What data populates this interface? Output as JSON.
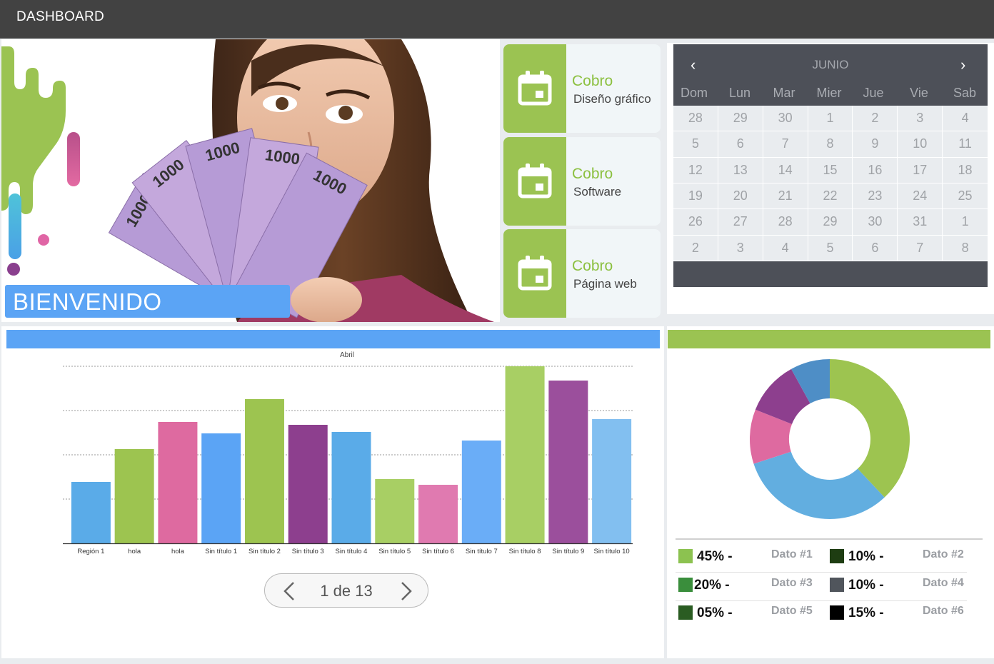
{
  "header": {
    "title": "DASHBOARD"
  },
  "hero": {
    "welcome": "BIENVENIDO",
    "image": "woman-holding-money-image",
    "banknote_labels": [
      "1000",
      "1000",
      "1000",
      "1000",
      "1000"
    ]
  },
  "cobros": [
    {
      "title": "Cobro",
      "subtitle": "Diseño gráfico",
      "icon": "calendar-icon"
    },
    {
      "title": "Cobro",
      "subtitle": "Software",
      "icon": "calendar-icon"
    },
    {
      "title": "Cobro",
      "subtitle": "Página web",
      "icon": "calendar-icon"
    }
  ],
  "calendar": {
    "month": "JUNIO",
    "prev": "‹",
    "next": "›",
    "weekdays": [
      "Dom",
      "Lun",
      "Mar",
      "Mier",
      "Jue",
      "Vie",
      "Sab"
    ],
    "weeks": [
      [
        "28",
        "29",
        "30",
        "1",
        "2",
        "3",
        "4"
      ],
      [
        "5",
        "6",
        "7",
        "8",
        "9",
        "10",
        "11"
      ],
      [
        "12",
        "13",
        "14",
        "15",
        "16",
        "17",
        "18"
      ],
      [
        "19",
        "20",
        "21",
        "22",
        "23",
        "24",
        "25"
      ],
      [
        "26",
        "27",
        "28",
        "29",
        "30",
        "31",
        "1"
      ],
      [
        "2",
        "3",
        "4",
        "5",
        "6",
        "7",
        "8"
      ]
    ]
  },
  "pager": {
    "text": "1 de 13"
  },
  "chart_data": [
    {
      "type": "bar",
      "title": "Abril",
      "categories": [
        "Región 1",
        "hola",
        "hola",
        "Sin título 1",
        "Sin título 2",
        "Sin título 3",
        "Sin título 4",
        "Sin título 5",
        "Sin título 6",
        "Sin título 7",
        "Sin título 8",
        "Sin título 9",
        "Sin título 10"
      ],
      "values": [
        86,
        132,
        170,
        154,
        202,
        166,
        156,
        90,
        82,
        144,
        248,
        228,
        174
      ],
      "colors": [
        "#5aabe8",
        "#9dc450",
        "#de6aa0",
        "#5ba4f5",
        "#9dc450",
        "#8d3f8e",
        "#5aabe8",
        "#a8cf64",
        "#e07ab0",
        "#6aadf7",
        "#a8cf64",
        "#9b4f9c",
        "#82bff0"
      ],
      "ylim": [
        0,
        248
      ],
      "grid": true
    },
    {
      "type": "pie",
      "slices": [
        {
          "name": "slice-1",
          "value": 38,
          "color": "#9dc450"
        },
        {
          "name": "slice-2",
          "value": 32,
          "color": "#62aee0"
        },
        {
          "name": "slice-3",
          "value": 11,
          "color": "#de6aa0"
        },
        {
          "name": "slice-4",
          "value": 11,
          "color": "#8d3f8e"
        },
        {
          "name": "slice-5",
          "value": 8,
          "color": "#4e8ec6"
        }
      ]
    }
  ],
  "legend": [
    {
      "pct": "45% -",
      "label": "Dato #1",
      "color": "#8cc250"
    },
    {
      "pct": "10% -",
      "label": "Dato #2",
      "color": "#1e3d12"
    },
    {
      "pct": "20% -",
      "label": "Dato #3",
      "color": "#3a8e3c"
    },
    {
      "pct": "10% -",
      "label": "Dato #4",
      "color": "#50555c"
    },
    {
      "pct": "05% -",
      "label": "Dato #5",
      "color": "#2a5c22"
    },
    {
      "pct": "15% -",
      "label": "Dato #6",
      "color": "#000000"
    }
  ]
}
